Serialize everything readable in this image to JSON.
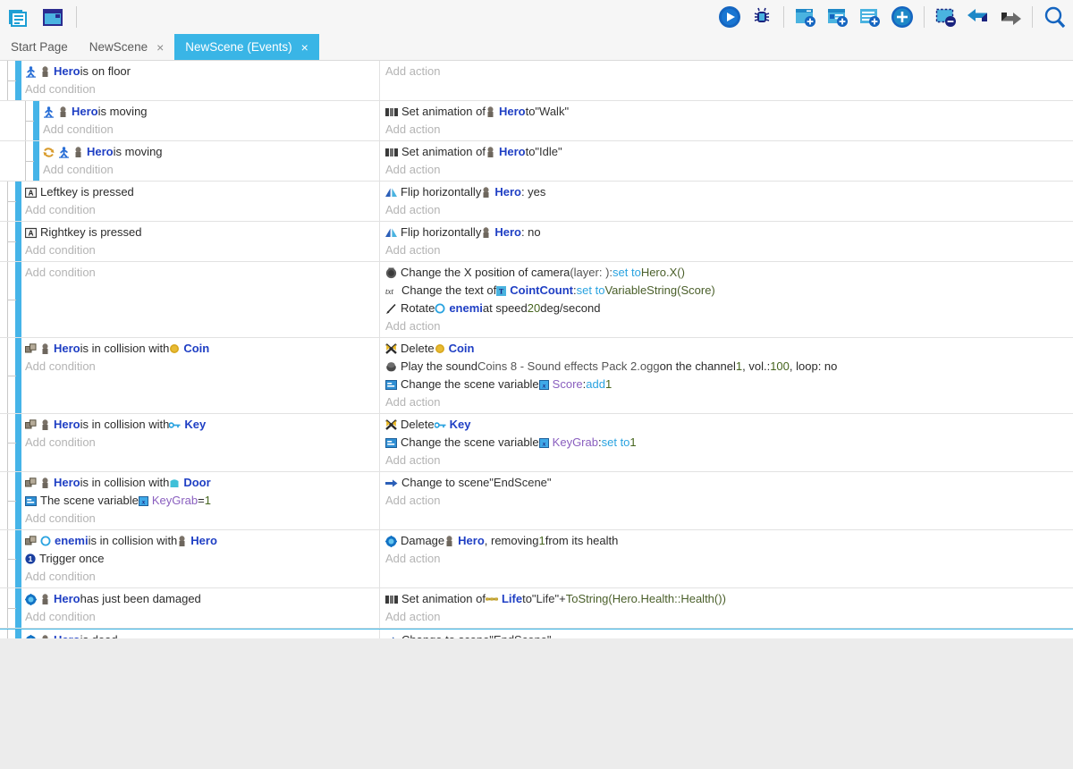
{
  "toolbar": {
    "left_icons": [
      {
        "name": "project-manager-icon",
        "label": "Project manager"
      },
      {
        "name": "scene-editor-icon",
        "label": "Scene editor"
      }
    ],
    "right_icons": [
      {
        "name": "play-preview-icon",
        "label": "Preview"
      },
      {
        "name": "debug-icon",
        "label": "Debug"
      },
      {
        "name": "add-scene-icon",
        "label": "Add scene"
      },
      {
        "name": "add-external-layout-icon",
        "label": "Add external layout"
      },
      {
        "name": "add-external-events-icon",
        "label": "Add external events"
      },
      {
        "name": "add-object-icon",
        "label": "Add object"
      },
      {
        "name": "delete-selection-icon",
        "label": "Delete selection"
      },
      {
        "name": "undo-icon",
        "label": "Undo"
      },
      {
        "name": "redo-icon",
        "label": "Redo"
      },
      {
        "name": "search-icon",
        "label": "Search"
      }
    ]
  },
  "tabs": [
    {
      "label": "Start Page",
      "closable": false,
      "active": false
    },
    {
      "label": "NewScene",
      "closable": true,
      "active": false,
      "close": "×"
    },
    {
      "label": "NewScene (Events)",
      "closable": true,
      "active": true,
      "close": "×"
    }
  ],
  "placeholders": {
    "add_condition": "Add condition",
    "add_action": "Add action"
  },
  "colors": {
    "accent": "#39b5e6",
    "event_bar": "#45b4e8",
    "object_name": "#1f3fc4",
    "keyword": "#2aa3e0",
    "number": "#46651e",
    "variable": "#8a5fbf",
    "placeholder": "#b4b4b4",
    "sheet_bg": "#ffffff",
    "app_bg": "#ececec"
  },
  "events": [
    {
      "id": "evt-hero-on-floor",
      "indent": 0,
      "selected": false,
      "conditions": [
        {
          "icons": [
            "platformer-icon",
            "sprite-icon"
          ],
          "parts": [
            {
              "t": "obj",
              "v": "Hero"
            },
            {
              "t": "txt",
              "v": " is on floor"
            }
          ]
        }
      ],
      "actions": []
    },
    {
      "id": "evt-hero-is-moving-walk",
      "indent": 1,
      "selected": false,
      "conditions": [
        {
          "icons": [
            "platformer-icon",
            "sprite-icon"
          ],
          "parts": [
            {
              "t": "obj",
              "v": "Hero"
            },
            {
              "t": "txt",
              "v": " is moving"
            }
          ]
        }
      ],
      "actions": [
        {
          "icons": [
            "animation-icon"
          ],
          "parts": [
            {
              "t": "txt",
              "v": "Set animation of "
            },
            {
              "t": "icon",
              "v": "sprite-icon"
            },
            {
              "t": "obj",
              "v": "Hero"
            },
            {
              "t": "txt",
              "v": " to "
            },
            {
              "t": "str",
              "v": "\"Walk\""
            }
          ]
        }
      ]
    },
    {
      "id": "evt-hero-not-moving-idle",
      "indent": 1,
      "selected": false,
      "conditions": [
        {
          "icons": [
            "invert-icon",
            "platformer-icon",
            "sprite-icon"
          ],
          "parts": [
            {
              "t": "obj",
              "v": "Hero"
            },
            {
              "t": "txt",
              "v": " is moving"
            }
          ]
        }
      ],
      "actions": [
        {
          "icons": [
            "animation-icon"
          ],
          "parts": [
            {
              "t": "txt",
              "v": "Set animation of "
            },
            {
              "t": "icon",
              "v": "sprite-icon"
            },
            {
              "t": "obj",
              "v": "Hero"
            },
            {
              "t": "txt",
              "v": " to "
            },
            {
              "t": "str",
              "v": "\"Idle\""
            }
          ]
        }
      ]
    },
    {
      "id": "evt-left-key",
      "indent": 0,
      "selected": false,
      "conditions": [
        {
          "icons": [
            "keyboard-icon"
          ],
          "parts": [
            {
              "t": "txt",
              "v": "Left"
            },
            {
              "t": "txt",
              "v": " key is pressed"
            }
          ]
        }
      ],
      "actions": [
        {
          "icons": [
            "flip-icon"
          ],
          "parts": [
            {
              "t": "txt",
              "v": "Flip horizontally "
            },
            {
              "t": "icon",
              "v": "sprite-icon"
            },
            {
              "t": "obj",
              "v": "Hero"
            },
            {
              "t": "txt",
              "v": " : yes"
            }
          ]
        }
      ]
    },
    {
      "id": "evt-right-key",
      "indent": 0,
      "selected": false,
      "conditions": [
        {
          "icons": [
            "keyboard-icon"
          ],
          "parts": [
            {
              "t": "txt",
              "v": "Right"
            },
            {
              "t": "txt",
              "v": " key is pressed"
            }
          ]
        }
      ],
      "actions": [
        {
          "icons": [
            "flip-icon"
          ],
          "parts": [
            {
              "t": "txt",
              "v": "Flip horizontally "
            },
            {
              "t": "icon",
              "v": "sprite-icon"
            },
            {
              "t": "obj",
              "v": "Hero"
            },
            {
              "t": "txt",
              "v": " : no"
            }
          ]
        }
      ]
    },
    {
      "id": "evt-camera-ui",
      "indent": 0,
      "selected": false,
      "conditions": [],
      "actions": [
        {
          "icons": [
            "camera-icon"
          ],
          "parts": [
            {
              "t": "txt",
              "v": "Change the X position of camera "
            },
            {
              "t": "gray",
              "v": "(layer: ): "
            },
            {
              "t": "kw",
              "v": "set to"
            },
            {
              "t": "txt",
              "v": " "
            },
            {
              "t": "expr",
              "v": "Hero.X()"
            }
          ]
        },
        {
          "icons": [
            "text-icon"
          ],
          "parts": [
            {
              "t": "txt",
              "v": "Change the text of "
            },
            {
              "t": "icon",
              "v": "textobject-icon"
            },
            {
              "t": "obj",
              "v": "CointCount"
            },
            {
              "t": "txt",
              "v": ": "
            },
            {
              "t": "kw",
              "v": "set to"
            },
            {
              "t": "txt",
              "v": " "
            },
            {
              "t": "expr",
              "v": "VariableString(Score)"
            }
          ]
        },
        {
          "icons": [
            "rotate-icon"
          ],
          "parts": [
            {
              "t": "txt",
              "v": "Rotate "
            },
            {
              "t": "icon",
              "v": "circle-object-icon"
            },
            {
              "t": "obj",
              "v": "enemi"
            },
            {
              "t": "txt",
              "v": " at speed "
            },
            {
              "t": "num",
              "v": "20"
            },
            {
              "t": "txt",
              "v": "deg/second"
            }
          ]
        }
      ]
    },
    {
      "id": "evt-hero-coin",
      "indent": 0,
      "selected": false,
      "conditions": [
        {
          "icons": [
            "collision-icon",
            "sprite-icon"
          ],
          "parts": [
            {
              "t": "obj",
              "v": "Hero"
            },
            {
              "t": "txt",
              "v": " is in collision with "
            },
            {
              "t": "icon",
              "v": "coin-icon"
            },
            {
              "t": "obj",
              "v": "Coin"
            }
          ]
        }
      ],
      "actions": [
        {
          "icons": [
            "delete-icon"
          ],
          "parts": [
            {
              "t": "txt",
              "v": "Delete "
            },
            {
              "t": "icon",
              "v": "coin-icon"
            },
            {
              "t": "obj",
              "v": "Coin"
            }
          ]
        },
        {
          "icons": [
            "sound-icon"
          ],
          "parts": [
            {
              "t": "txt",
              "v": "Play the sound "
            },
            {
              "t": "gray",
              "v": "Coins 8 - Sound effects Pack 2.ogg"
            },
            {
              "t": "txt",
              "v": " on the channel "
            },
            {
              "t": "num",
              "v": "1"
            },
            {
              "t": "txt",
              "v": ", vol.: "
            },
            {
              "t": "num",
              "v": "100"
            },
            {
              "t": "txt",
              "v": ", loop: no"
            }
          ]
        },
        {
          "icons": [
            "variable-icon"
          ],
          "parts": [
            {
              "t": "txt",
              "v": "Change the scene variable "
            },
            {
              "t": "icon",
              "v": "var-badge-icon"
            },
            {
              "t": "var",
              "v": "Score"
            },
            {
              "t": "txt",
              "v": ": "
            },
            {
              "t": "kw",
              "v": "add"
            },
            {
              "t": "txt",
              "v": " "
            },
            {
              "t": "num",
              "v": "1"
            }
          ]
        }
      ]
    },
    {
      "id": "evt-hero-key",
      "indent": 0,
      "selected": false,
      "conditions": [
        {
          "icons": [
            "collision-icon",
            "sprite-icon"
          ],
          "parts": [
            {
              "t": "obj",
              "v": "Hero"
            },
            {
              "t": "txt",
              "v": " is in collision with "
            },
            {
              "t": "icon",
              "v": "key-icon"
            },
            {
              "t": "obj",
              "v": "Key"
            }
          ]
        }
      ],
      "actions": [
        {
          "icons": [
            "delete-icon"
          ],
          "parts": [
            {
              "t": "txt",
              "v": "Delete "
            },
            {
              "t": "icon",
              "v": "key-icon"
            },
            {
              "t": "obj",
              "v": "Key"
            }
          ]
        },
        {
          "icons": [
            "variable-icon"
          ],
          "parts": [
            {
              "t": "txt",
              "v": "Change the scene variable "
            },
            {
              "t": "icon",
              "v": "var-badge-icon"
            },
            {
              "t": "var",
              "v": "KeyGrab"
            },
            {
              "t": "txt",
              "v": ": "
            },
            {
              "t": "kw",
              "v": "set to"
            },
            {
              "t": "txt",
              "v": " "
            },
            {
              "t": "num",
              "v": "1"
            }
          ]
        }
      ]
    },
    {
      "id": "evt-hero-door",
      "indent": 0,
      "selected": false,
      "conditions": [
        {
          "icons": [
            "collision-icon",
            "sprite-icon"
          ],
          "parts": [
            {
              "t": "obj",
              "v": "Hero"
            },
            {
              "t": "txt",
              "v": " is in collision with "
            },
            {
              "t": "icon",
              "v": "door-icon"
            },
            {
              "t": "obj",
              "v": "Door"
            }
          ]
        },
        {
          "icons": [
            "variable-icon"
          ],
          "parts": [
            {
              "t": "txt",
              "v": "The scene variable "
            },
            {
              "t": "icon",
              "v": "var-badge-icon"
            },
            {
              "t": "var",
              "v": "KeyGrab"
            },
            {
              "t": "txt",
              "v": " = "
            },
            {
              "t": "num",
              "v": "1"
            }
          ]
        }
      ],
      "actions": [
        {
          "icons": [
            "scene-change-icon"
          ],
          "parts": [
            {
              "t": "txt",
              "v": "Change to scene "
            },
            {
              "t": "str",
              "v": "\"EndScene\""
            }
          ]
        }
      ]
    },
    {
      "id": "evt-enemi-hero",
      "indent": 0,
      "selected": false,
      "conditions": [
        {
          "icons": [
            "collision-icon",
            "circle-object-icon"
          ],
          "parts": [
            {
              "t": "obj",
              "v": "enemi"
            },
            {
              "t": "txt",
              "v": " is in collision with "
            },
            {
              "t": "icon",
              "v": "sprite-icon"
            },
            {
              "t": "obj",
              "v": "Hero"
            }
          ]
        },
        {
          "icons": [
            "trigger-once-icon"
          ],
          "parts": [
            {
              "t": "txt",
              "v": "Trigger once"
            }
          ]
        }
      ],
      "actions": [
        {
          "icons": [
            "health-icon"
          ],
          "parts": [
            {
              "t": "txt",
              "v": "Damage "
            },
            {
              "t": "icon",
              "v": "sprite-icon"
            },
            {
              "t": "obj",
              "v": "Hero"
            },
            {
              "t": "txt",
              "v": ", removing "
            },
            {
              "t": "num",
              "v": "1"
            },
            {
              "t": "txt",
              "v": " from its health"
            }
          ]
        }
      ]
    },
    {
      "id": "evt-hero-damaged",
      "indent": 0,
      "selected": false,
      "conditions": [
        {
          "icons": [
            "health-icon",
            "sprite-icon"
          ],
          "parts": [
            {
              "t": "obj",
              "v": "Hero"
            },
            {
              "t": "txt",
              "v": " has just been damaged"
            }
          ]
        }
      ],
      "actions": [
        {
          "icons": [
            "animation-icon"
          ],
          "parts": [
            {
              "t": "txt",
              "v": "Set animation of "
            },
            {
              "t": "icon",
              "v": "life-icon"
            },
            {
              "t": "obj",
              "v": "Life"
            },
            {
              "t": "txt",
              "v": " to "
            },
            {
              "t": "str",
              "v": "\"Life\""
            },
            {
              "t": "txt",
              "v": " + "
            },
            {
              "t": "expr",
              "v": "ToString(Hero.Health::Health())"
            }
          ]
        }
      ]
    },
    {
      "id": "evt-hero-dead",
      "indent": 0,
      "selected": true,
      "conditions": [
        {
          "icons": [
            "health-icon",
            "sprite-icon"
          ],
          "parts": [
            {
              "t": "obj",
              "v": "Hero"
            },
            {
              "t": "txt",
              "v": " is dead"
            }
          ]
        }
      ],
      "actions": [
        {
          "icons": [
            "scene-change-icon"
          ],
          "parts": [
            {
              "t": "txt",
              "v": "Change to scene "
            },
            {
              "t": "str",
              "v": "\"EndScene\""
            }
          ]
        }
      ]
    }
  ]
}
